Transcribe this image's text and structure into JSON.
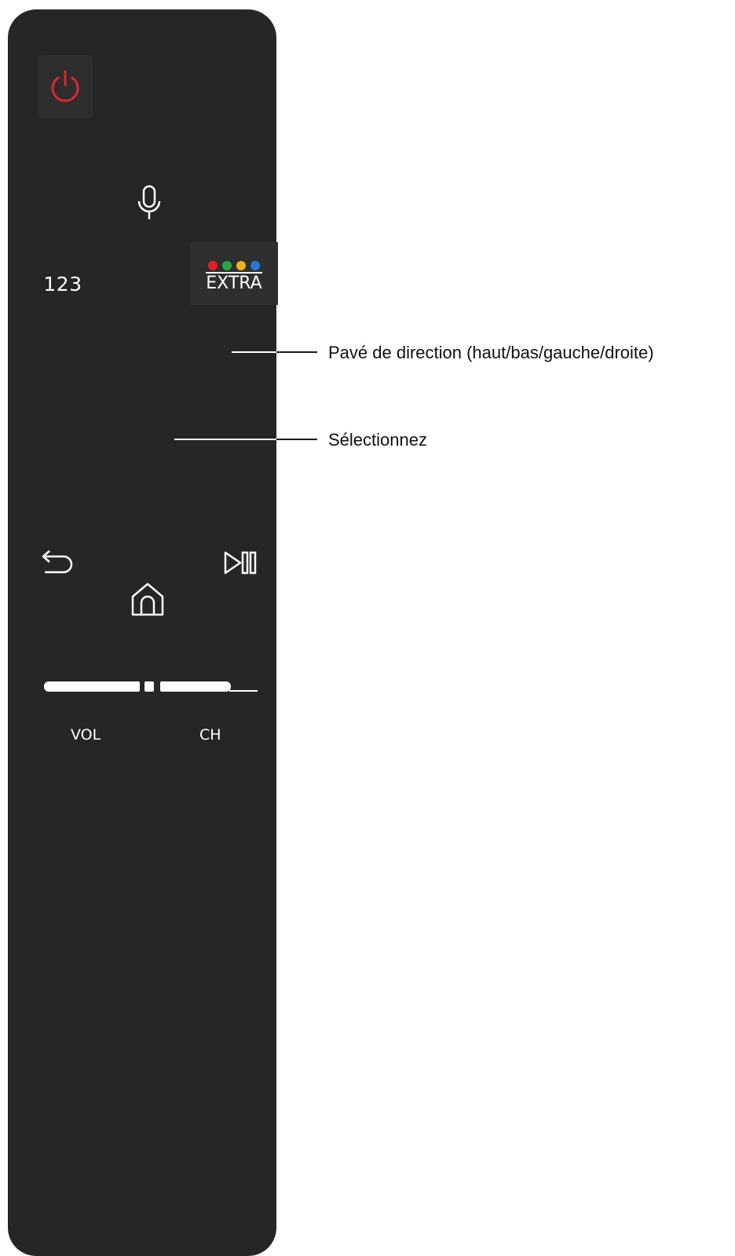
{
  "remote": {
    "buttons": {
      "power_icon": "power-icon",
      "mic_icon": "microphone-icon",
      "numbers_label": "123",
      "extra_label": "EXTRA",
      "extra_colors": [
        "#e31e24",
        "#27a844",
        "#f2b417",
        "#2877d4"
      ],
      "back_icon": "return-arrow-icon",
      "play_pause_icon": "play-pause-icon",
      "home_icon": "home-icon",
      "volume_label": "VOL",
      "channel_label": "CH"
    }
  },
  "callouts": {
    "direction_pad": "Pavé de direction (haut/bas/gauche/droite)",
    "select": "Sélectionnez"
  },
  "colors": {
    "remote_body": "#262626",
    "power_accent": "#e0262a",
    "icon": "#ffffff"
  }
}
